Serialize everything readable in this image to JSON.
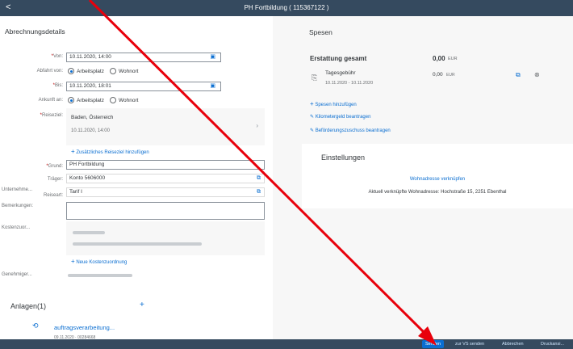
{
  "header": {
    "back": "<",
    "title": "PH Fortbildung ( 115367122 )"
  },
  "left": {
    "heading": "Abrechnungsdetails",
    "von_label": "Von:",
    "von_value": "10.11.2020, 14:00",
    "abfahrt_label": "Abfahrt von:",
    "abfahrt_opt1": "Arbeitsplatz",
    "abfahrt_opt2": "Wohnort",
    "bis_label": "Bis:",
    "bis_value": "10.11.2020, 18:01",
    "ankunft_label": "Ankunft an:",
    "ankunft_opt1": "Arbeitsplatz",
    "ankunft_opt2": "Wohnort",
    "reiseziel_label": "Reiseziel:",
    "reiseziel_place": "Baden, Österreich",
    "reiseziel_time": "10.11.2020, 14:00",
    "add_reiseziel": "Zusätzliches Reiseziel hinzufügen",
    "grund_label": "Grund:",
    "grund_value": "PH Fortbildung",
    "traeger_label": "Träger:",
    "traeger_value": "Konto 5606000",
    "unternehmen_label1": "Unternehme...",
    "unternehmen_label2": "Reiseart:",
    "unternehmen_value": "Tarif I",
    "bemerkungen_label": "Bemerkungen:",
    "kosten_label": "Kostenzuor...",
    "neue_kosten": "Neue Kostenzuordnung",
    "genehmiger_label": "Genehmiger...",
    "anlagen_heading": "Anlagen(1)",
    "anlagen_add": "+",
    "attachment_name": "auftragsverarbeitung...",
    "attachment_meta": "09.11.2020 · 00284668"
  },
  "right": {
    "heading": "Spesen",
    "total_label": "Erstattung gesamt",
    "total_amount": "0,00",
    "total_currency": "EUR",
    "item_title": "Tagesgebühr",
    "item_dates": "10.11.2020 - 10.11.2020",
    "item_amount": "0,00",
    "item_currency": "EUR",
    "action1": "Spesen hinzufügen",
    "action2": "Kilometergeld beantragen",
    "action3": "Beförderungszuschuss beantragen",
    "settings_heading": "Einstellungen",
    "settings_link": "Wohnadresse verknüpfen",
    "settings_text": "Aktuell verknüpfte Wohnadresse: Hochstraße 15, 2251 Ebenthal"
  },
  "footer": {
    "btn1": "Senden",
    "btn2": "zur VS senden",
    "btn3": "Abbrechen",
    "btn4": "Druckansi..."
  },
  "colors": {
    "shell": "#354a5f",
    "accent": "#0a6ed1",
    "arrow": "#e8000b"
  }
}
